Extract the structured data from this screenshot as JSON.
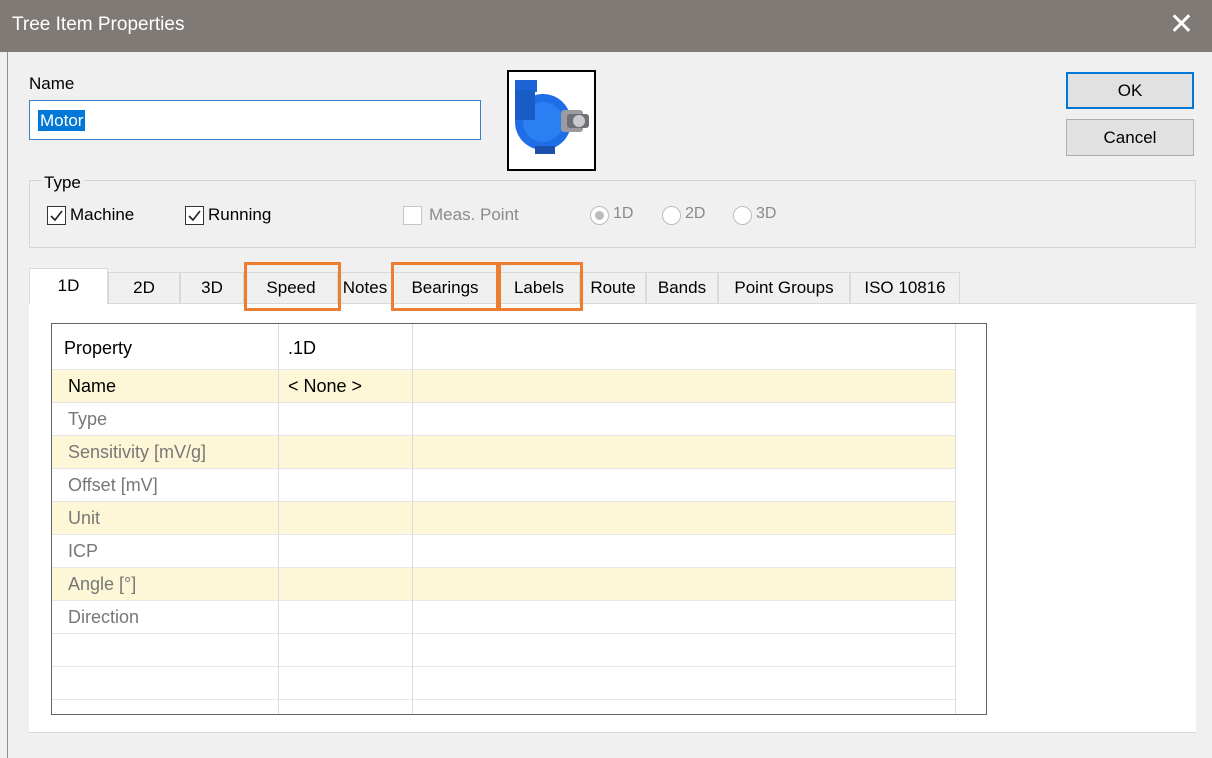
{
  "window": {
    "title": "Tree Item Properties",
    "close_glyph": "✕"
  },
  "name_field": {
    "label": "Name",
    "value": "Motor"
  },
  "picture": {
    "icon": "blue-motor-fan-image"
  },
  "buttons": {
    "ok": "OK",
    "cancel": "Cancel"
  },
  "type_group": {
    "legend": "Type",
    "machine": {
      "label": "Machine",
      "checked": true
    },
    "running": {
      "label": "Running",
      "checked": true
    },
    "meas_point": {
      "label": "Meas. Point",
      "checked": false,
      "disabled": true
    },
    "radios": [
      {
        "label": "1D",
        "selected": true
      },
      {
        "label": "2D",
        "selected": false
      },
      {
        "label": "3D",
        "selected": false
      }
    ]
  },
  "tabs": [
    "1D",
    "2D",
    "3D",
    "Speed",
    "Notes",
    "Bearings",
    "Labels",
    "Route",
    "Bands",
    "Point Groups",
    "ISO 10816"
  ],
  "active_tab": "1D",
  "highlighted_tabs": [
    "Speed",
    "Bearings",
    "Labels"
  ],
  "highlight_color": "#ed7d31",
  "grid": {
    "headers": [
      "Property",
      ".1D"
    ],
    "rows": [
      {
        "property": "Name",
        "value": "< None >"
      },
      {
        "property": "Type",
        "value": ""
      },
      {
        "property": "Sensitivity [mV/g]",
        "value": ""
      },
      {
        "property": "Offset [mV]",
        "value": ""
      },
      {
        "property": "Unit",
        "value": ""
      },
      {
        "property": "ICP",
        "value": ""
      },
      {
        "property": "Angle [°]",
        "value": ""
      },
      {
        "property": "Direction",
        "value": ""
      }
    ]
  }
}
